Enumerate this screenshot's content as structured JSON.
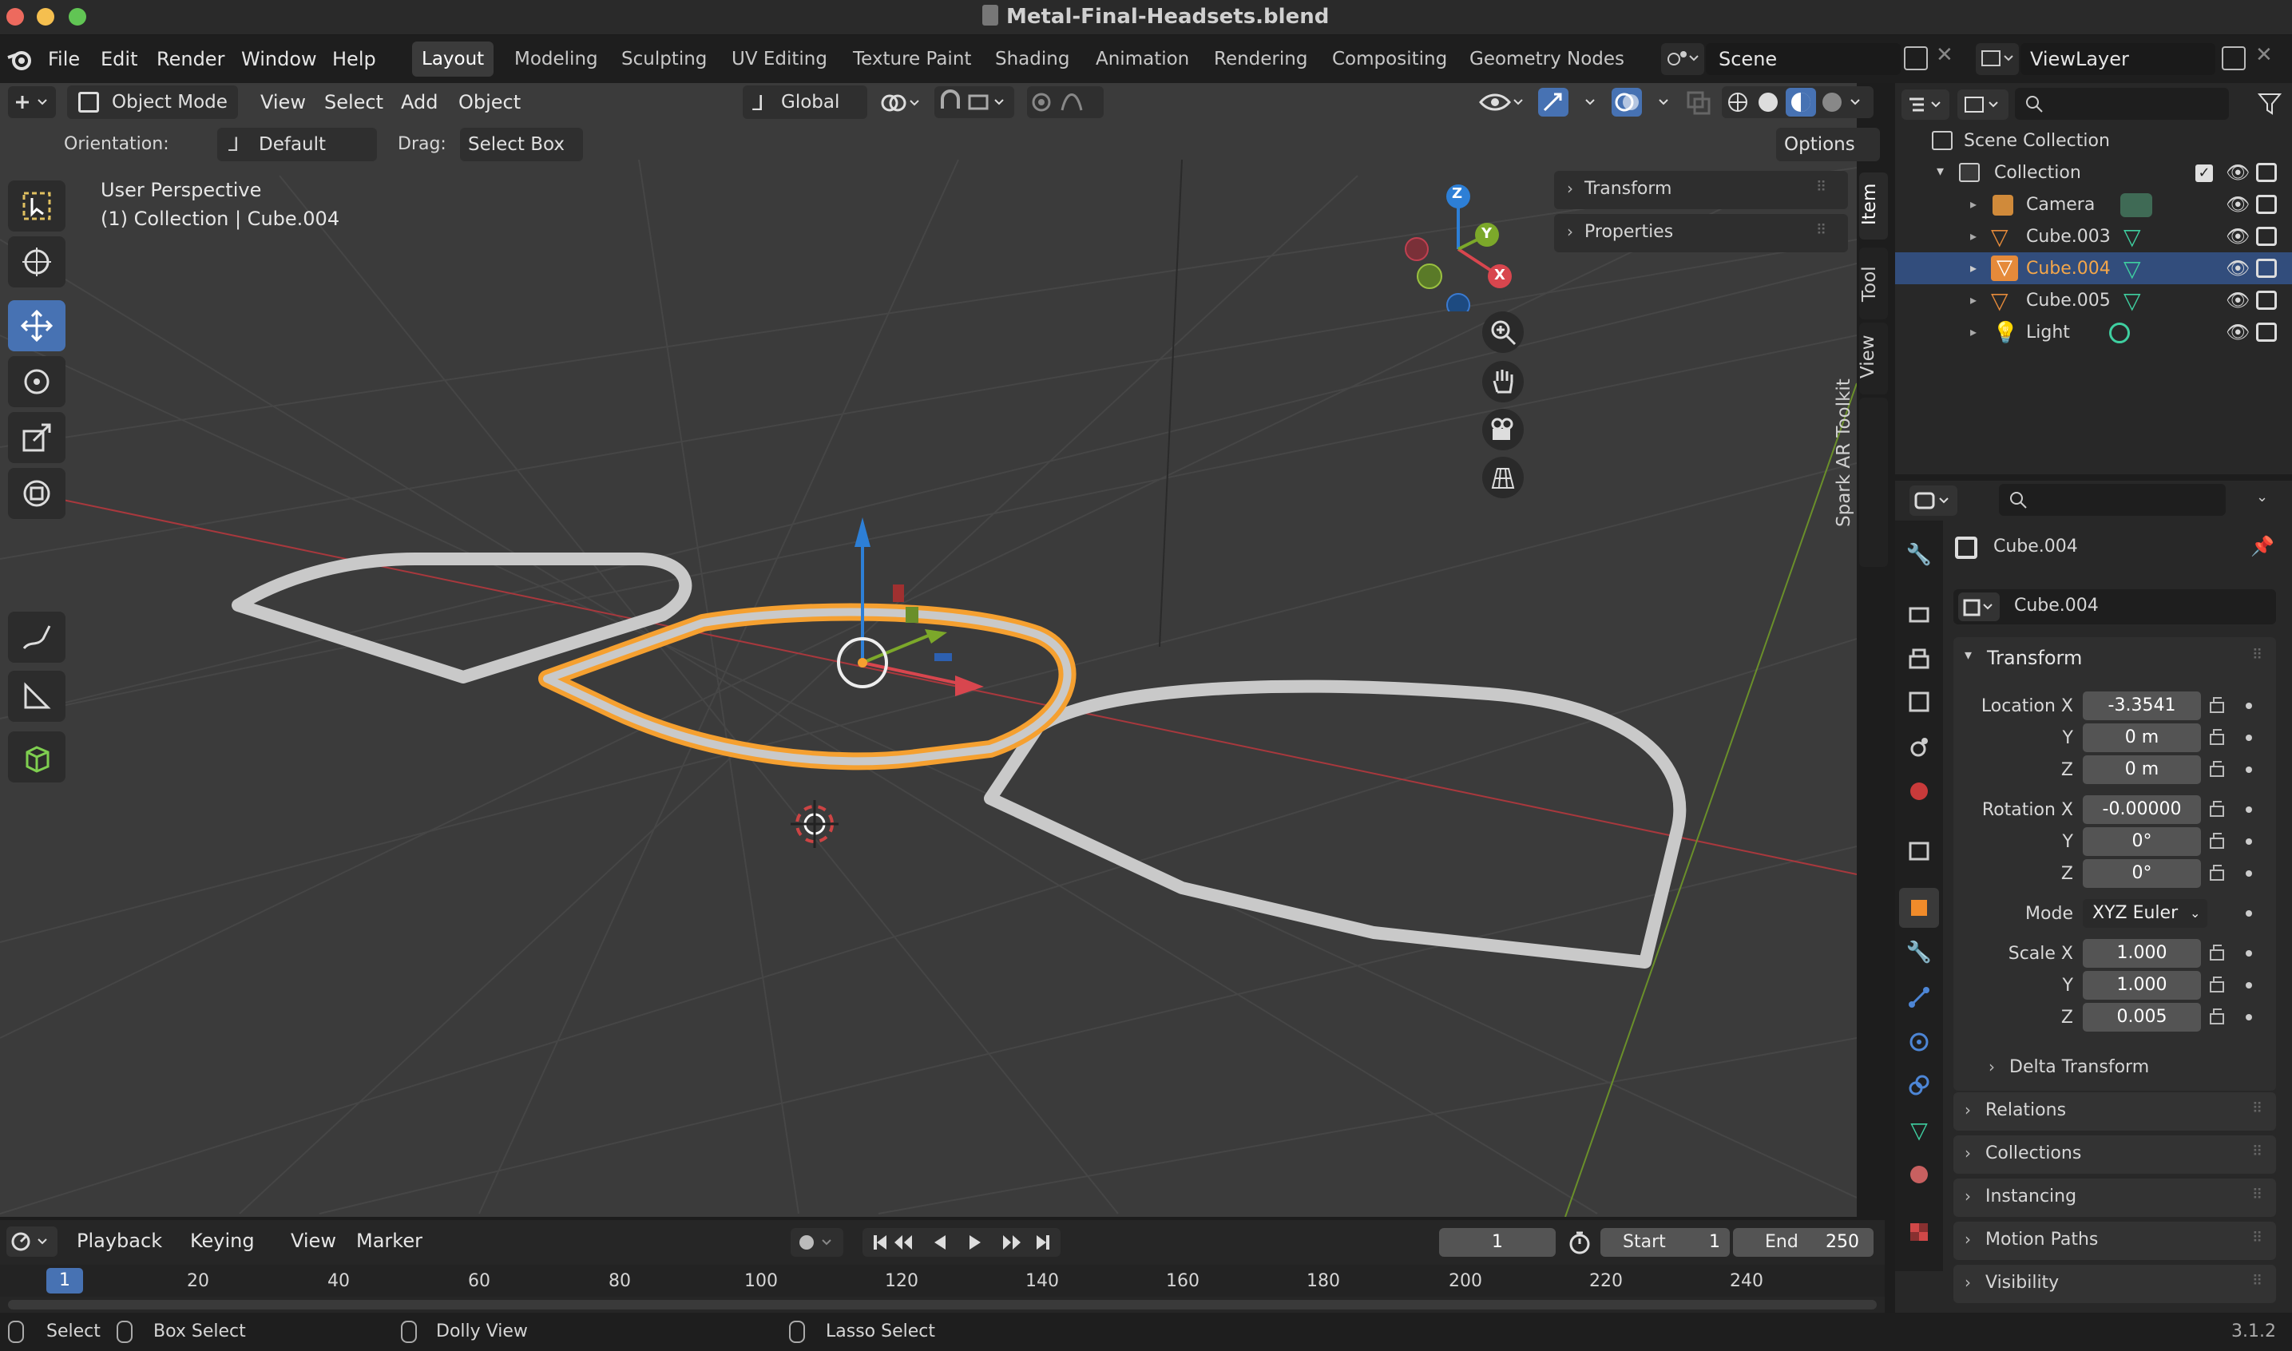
{
  "window": {
    "title": "Metal-Final-Headsets.blend"
  },
  "menu": {
    "file": "File",
    "edit": "Edit",
    "render": "Render",
    "window": "Window",
    "help": "Help"
  },
  "workspaces": [
    "Layout",
    "Modeling",
    "Sculpting",
    "UV Editing",
    "Texture Paint",
    "Shading",
    "Animation",
    "Rendering",
    "Compositing",
    "Geometry Nodes"
  ],
  "scene": {
    "name": "Scene",
    "view_layer": "ViewLayer"
  },
  "header": {
    "mode": "Object Mode",
    "view": "View",
    "select": "Select",
    "add": "Add",
    "object": "Object",
    "transform_orientation": "Global"
  },
  "tool_settings": {
    "orientation_label": "Orientation:",
    "orientation_value": "Default",
    "drag_label": "Drag:",
    "drag_value": "Select Box",
    "options": "Options"
  },
  "viewport": {
    "perspective": "User Perspective",
    "context": "(1) Collection | Cube.004"
  },
  "npanel": {
    "transform": "Transform",
    "properties": "Properties",
    "tabs": [
      "Item",
      "Tool",
      "View",
      "Spark AR Toolkit"
    ]
  },
  "gizmo": {
    "x": "X",
    "y": "Y",
    "z": "Z"
  },
  "outliner": {
    "root": "Scene Collection",
    "collection": "Collection",
    "items": [
      {
        "name": "Camera",
        "selected": false
      },
      {
        "name": "Cube.003",
        "selected": false
      },
      {
        "name": "Cube.004",
        "selected": true
      },
      {
        "name": "Cube.005",
        "selected": false
      },
      {
        "name": "Light",
        "selected": false
      }
    ]
  },
  "properties": {
    "object_name": "Cube.004",
    "object_field": "Cube.004",
    "transform_header": "Transform",
    "location": {
      "label_x": "Location X",
      "label_y": "Y",
      "label_z": "Z",
      "x": "-3.3541",
      "y": "0 m",
      "z": "0 m"
    },
    "rotation": {
      "label_x": "Rotation X",
      "label_y": "Y",
      "label_z": "Z",
      "x": "-0.00000",
      "y": "0°",
      "z": "0°"
    },
    "mode": {
      "label": "Mode",
      "value": "XYZ Euler"
    },
    "scale": {
      "label_x": "Scale X",
      "label_y": "Y",
      "label_z": "Z",
      "x": "1.000",
      "y": "1.000",
      "z": "0.005"
    },
    "delta": "Delta Transform",
    "panels": [
      "Relations",
      "Collections",
      "Instancing",
      "Motion Paths",
      "Visibility"
    ]
  },
  "timeline": {
    "playback": "Playback",
    "keying": "Keying",
    "view": "View",
    "marker": "Marker",
    "current_frame": "1",
    "start_label": "Start",
    "start": "1",
    "end_label": "End",
    "end": "250",
    "ruler": [
      "1",
      "20",
      "40",
      "60",
      "80",
      "100",
      "120",
      "140",
      "160",
      "180",
      "200",
      "220",
      "240"
    ]
  },
  "status": {
    "select": "Select",
    "box_select": "Box Select",
    "dolly": "Dolly View",
    "lasso": "Lasso Select",
    "version": "3.1.2"
  },
  "colors": {
    "accent": "#4772b3",
    "selection": "#f5a030",
    "x_axis": "#d8464e",
    "y_axis": "#7ca82a",
    "z_axis": "#2d7fd6"
  }
}
